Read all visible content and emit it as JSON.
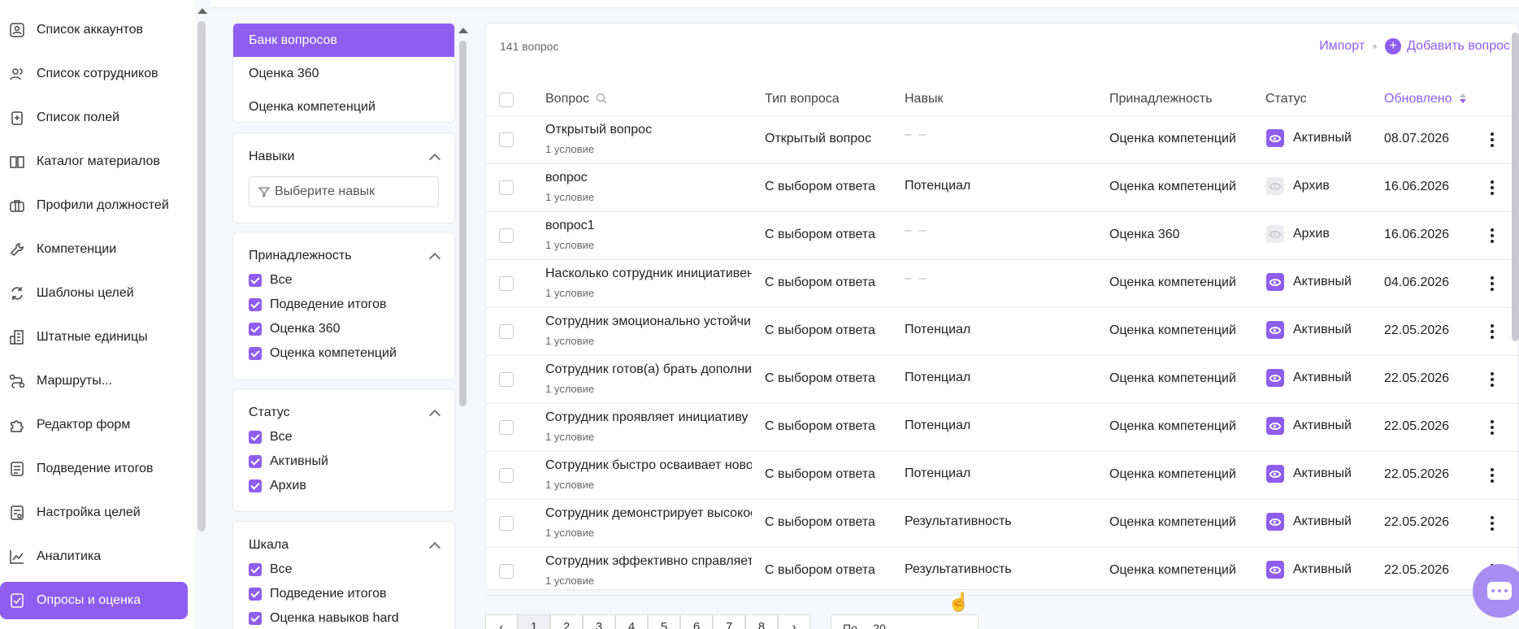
{
  "nav": {
    "items": [
      {
        "label": "Список аккаунтов",
        "icon": "user-card-icon"
      },
      {
        "label": "Список сотрудников",
        "icon": "users-icon"
      },
      {
        "label": "Список полей",
        "icon": "clipboard-icon"
      },
      {
        "label": "Каталог материалов",
        "icon": "book-icon"
      },
      {
        "label": "Профили должностей",
        "icon": "briefcase-icon"
      },
      {
        "label": "Компетенции",
        "icon": "wrench-icon"
      },
      {
        "label": "Шаблоны целей",
        "icon": "refresh-icon"
      },
      {
        "label": "Штатные единицы",
        "icon": "building-icon"
      },
      {
        "label": "Маршруты...",
        "icon": "route-icon"
      },
      {
        "label": "Редактор форм",
        "icon": "puzzle-icon"
      },
      {
        "label": "Подведение итогов",
        "icon": "document-icon"
      },
      {
        "label": "Настройка целей",
        "icon": "settings-doc-icon"
      },
      {
        "label": "Аналитика",
        "icon": "chart-icon"
      },
      {
        "label": "Опросы и оценка",
        "icon": "survey-icon",
        "active": true
      }
    ]
  },
  "filters": {
    "bank": [
      "Банк вопросов",
      "Оценка 360",
      "Оценка компетенций"
    ],
    "skills": {
      "title": "Навыки",
      "placeholder": "Выберите навык"
    },
    "ownership": {
      "title": "Принадлежность",
      "options": [
        "Все",
        "Подведение итогов",
        "Оценка 360",
        "Оценка компетенций"
      ]
    },
    "status": {
      "title": "Статус",
      "options": [
        "Все",
        "Активный",
        "Архив"
      ]
    },
    "scale": {
      "title": "Шкала",
      "options": [
        "Все",
        "Подведение итогов",
        "Оценка навыков hard"
      ]
    }
  },
  "table": {
    "count": "141 вопрос",
    "import_label": "Импорт",
    "add_label": "Добавить вопрос",
    "headers": {
      "question": "Вопрос",
      "type": "Тип вопроса",
      "skill": "Навык",
      "ownership": "Принадлежность",
      "status": "Статус",
      "updated": "Обновлено"
    },
    "rows": [
      {
        "question": "Открытый вопрос",
        "sub": "1 условие",
        "type": "Открытый вопрос",
        "skill": "– –",
        "ownership": "Оценка компетенций",
        "status": "Активный",
        "archived": false,
        "updated": "08.07.2026"
      },
      {
        "question": "вопрос",
        "sub": "1 условие",
        "type": "С выбором ответа",
        "skill": "Потенциал",
        "ownership": "Оценка компетенций",
        "status": "Архив",
        "archived": true,
        "updated": "16.06.2026"
      },
      {
        "question": "вопрос1",
        "sub": "1 условие",
        "type": "С выбором ответа",
        "skill": "– –",
        "ownership": "Оценка 360",
        "status": "Архив",
        "archived": true,
        "updated": "16.06.2026"
      },
      {
        "question": "Насколько сотрудник инициативен",
        "sub": "1 условие",
        "type": "С выбором ответа",
        "skill": "– –",
        "ownership": "Оценка компетенций",
        "status": "Активный",
        "archived": false,
        "updated": "04.06.2026"
      },
      {
        "question": "Сотрудник эмоционально устойчив",
        "sub": "1 условие",
        "type": "С выбором ответа",
        "skill": "Потенциал",
        "ownership": "Оценка компетенций",
        "status": "Активный",
        "archived": false,
        "updated": "22.05.2026"
      },
      {
        "question": "Сотрудник готов(а) брать дополнительные",
        "sub": "1 условие",
        "type": "С выбором ответа",
        "skill": "Потенциал",
        "ownership": "Оценка компетенций",
        "status": "Активный",
        "archived": false,
        "updated": "22.05.2026"
      },
      {
        "question": "Сотрудник проявляет инициативу",
        "sub": "1 условие",
        "type": "С выбором ответа",
        "skill": "Потенциал",
        "ownership": "Оценка компетенций",
        "status": "Активный",
        "archived": false,
        "updated": "22.05.2026"
      },
      {
        "question": "Сотрудник быстро осваивает новое",
        "sub": "1 условие",
        "type": "С выбором ответа",
        "skill": "Потенциал",
        "ownership": "Оценка компетенций",
        "status": "Активный",
        "archived": false,
        "updated": "22.05.2026"
      },
      {
        "question": "Сотрудник демонстрирует высокое",
        "sub": "1 условие",
        "type": "С выбором ответа",
        "skill": "Результативность",
        "ownership": "Оценка компетенций",
        "status": "Активный",
        "archived": false,
        "updated": "22.05.2026"
      },
      {
        "question": "Сотрудник эффективно справляется",
        "sub": "1 условие",
        "type": "С выбором ответа",
        "skill": "Результативность",
        "ownership": "Оценка компетенций",
        "status": "Активный",
        "archived": false,
        "updated": "22.05.2026"
      }
    ]
  },
  "pager": {
    "prev": "‹",
    "pages": [
      "1",
      "2",
      "3",
      "4",
      "5",
      "6",
      "7",
      "8"
    ],
    "next": "›",
    "per_page": "По ... 20"
  },
  "colors": {
    "accent": "#8f5df0"
  }
}
